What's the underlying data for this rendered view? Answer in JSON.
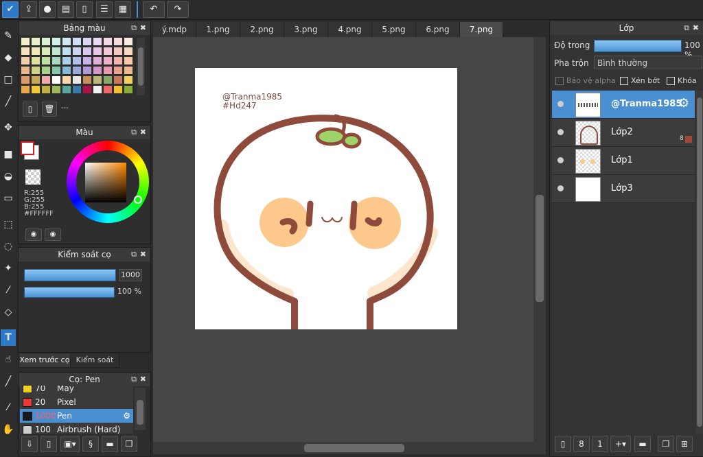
{
  "topbar": {
    "icons": [
      "app-icon",
      "share-icon",
      "comment-icon",
      "chat-icon",
      "document-icon",
      "list-icon",
      "grid-icon",
      "undo-icon",
      "redo-icon"
    ]
  },
  "tools": [
    "brush-icon",
    "eraser-icon",
    "shape-icon",
    "pen-icon",
    "move-icon",
    "fill-rect-icon",
    "bucket-icon",
    "gradient-icon",
    "select-rect-icon",
    "lasso-icon",
    "magic-wand-icon",
    "select-pen-icon",
    "select-eraser-icon",
    "text-icon",
    "hand-select-icon",
    "eyedropper-icon",
    "dropper-icon",
    "hand-icon"
  ],
  "palette": {
    "title": "Bảng màu",
    "colors": [
      [
        "#f6f0c8",
        "#e8f2c8",
        "#d8f0d0",
        "#d0f0e8",
        "#d0e8f4",
        "#d0e0f4",
        "#dcd8f4",
        "#ecd8f0",
        "#f4d8e8",
        "#f4dcdc",
        "#f8ece0",
        "#f4f4f4",
        "#f0e8d8",
        "#e8e8e8",
        "#dcdcdc",
        "#d0d0d0"
      ],
      [
        "#f8e0c0",
        "#f0e8b8",
        "#d8ecb8",
        "#c0e8d0",
        "#c0e0f0",
        "#c8d4f0",
        "#d8c8f0",
        "#ecc8e8",
        "#f4c8d8",
        "#f4c8c0",
        "#f8d8c0",
        "#e0f0f8",
        "#e8e0f0",
        "#f0d8e8",
        "#f8e8d0",
        "#e8f0d8"
      ],
      [
        "#f0d0a8",
        "#e0e0a0",
        "#c0e0a0",
        "#a8d8c0",
        "#a8d0e8",
        "#b0c0e8",
        "#c8b0e8",
        "#e0b0d8",
        "#f0b0c8",
        "#f0b4a8",
        "#f8c8a8",
        "#c8e8f0",
        "#d8d0f0",
        "#e8c8e0",
        "#f8e0c0",
        "#dce8c8"
      ],
      [
        "#e8b888",
        "#d0d088",
        "#a8d088",
        "#88c8a8",
        "#88b8d8",
        "#98a8d8",
        "#b098d8",
        "#d098c8",
        "#e898b0",
        "#e8a090",
        "#f0b890",
        "#a8d0e8",
        "#c0b8e8",
        "#d8b0d0",
        "#e8c8a0",
        "#c8d8b0"
      ],
      [
        "#e09868",
        "#c8a858",
        "#f0a8a8",
        "#ffffff",
        "#f8d8a8",
        "#e8e8e8",
        "#c89058",
        "#b8b878",
        "#88a868",
        "#c87858",
        "#f0d060",
        "#a0c8d8",
        "#e8a8a0",
        "#b8d8a8",
        "#d8c8a8",
        "#e8d8c8"
      ],
      [
        "#e8a848",
        "#f0c838",
        "#c0b040",
        "#a0b860",
        "#58a8a0",
        "#3878a8",
        "#b01048",
        "#f0f0f0",
        "#f06868",
        "#f0c030",
        "#88b038",
        "#e0a040",
        "#b87830",
        "#90a058",
        "#48a0b0",
        "#3870a0"
      ]
    ],
    "page_text": "---"
  },
  "color_panel": {
    "title": "Màu",
    "r": "R:255",
    "g": "G:255",
    "b": "B:255",
    "hex": "#FFFFFF"
  },
  "brush_control": {
    "title": "Kiểm soát cọ",
    "size": "1000",
    "opacity": "100 %"
  },
  "lower_tabs": {
    "preview": "Xem trước cọ",
    "brush_control": "Kiểm soát cọ"
  },
  "brush_list": {
    "title": "Cọ: Pen",
    "items": [
      {
        "size": "70",
        "name": "Mây",
        "color": "#f0d020"
      },
      {
        "size": "20",
        "name": "Pixel",
        "color": "#e83838"
      },
      {
        "size": "1000",
        "name": "Pen",
        "color": "#1a1a1a"
      },
      {
        "size": "100",
        "name": "Airbrush (Hard)",
        "color": "#cfcfcf"
      }
    ]
  },
  "tabs": [
    "ý.mdp",
    "1.png",
    "2.png",
    "3.png",
    "4.png",
    "5.png",
    "6.png",
    "7.png"
  ],
  "canvas": {
    "watermark_line1": "@Tranma1985",
    "watermark_line2": "#Hd247"
  },
  "layers_panel": {
    "title": "Lớp",
    "opacity_label": "Độ trong",
    "opacity_value": "100 %",
    "blend_label": "Pha trộn",
    "blend_value": "Bình thường",
    "protect_alpha": "Bảo vệ alpha",
    "clip": "Xén bớt",
    "lock": "Khóa",
    "layers": [
      {
        "name": "@Tranma1985",
        "selected": true
      },
      {
        "name": "Lớp2",
        "selected": false,
        "badge": "8"
      },
      {
        "name": "Lớp1",
        "selected": false
      },
      {
        "name": "Lớp3",
        "selected": false
      }
    ]
  }
}
